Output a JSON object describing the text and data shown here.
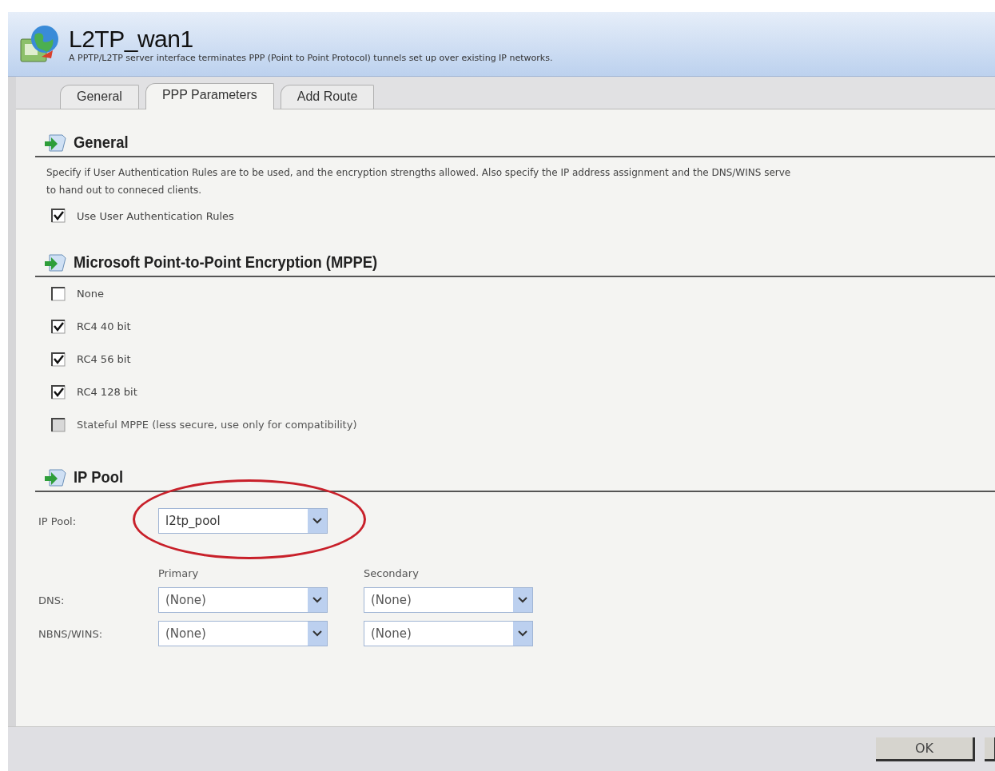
{
  "header": {
    "title": "L2TP_wan1",
    "subtitle": "A PPTP/L2TP server interface terminates PPP (Point to Point Protocol) tunnels set up over existing IP networks."
  },
  "tabs": [
    {
      "label": "General",
      "selected": false
    },
    {
      "label": "PPP Parameters",
      "selected": true
    },
    {
      "label": "Add Route",
      "selected": false
    }
  ],
  "general": {
    "heading": "General",
    "description_lines": [
      "Specify if User Authentication Rules are to be used, and the encryption strengths allowed. Also specify the IP address assignment and the DNS/WINS serve",
      "to hand out to conneced clients."
    ],
    "options": [
      {
        "label": "Use User Authentication Rules",
        "checked": true,
        "disabled": false
      }
    ]
  },
  "mppe": {
    "heading": "Microsoft Point-to-Point Encryption (MPPE)",
    "options": [
      {
        "label": "None",
        "checked": false,
        "disabled": false
      },
      {
        "label": "RC4 40 bit",
        "checked": true,
        "disabled": false
      },
      {
        "label": "RC4 56 bit",
        "checked": true,
        "disabled": false
      },
      {
        "label": "RC4 128 bit",
        "checked": true,
        "disabled": false
      },
      {
        "label": "Stateful MPPE (less secure, use only for compatibility)",
        "checked": false,
        "disabled": true
      }
    ]
  },
  "ip_pool": {
    "heading": "IP Pool",
    "label": "IP Pool:",
    "value": "l2tp_pool",
    "highlighted": true,
    "columns": [
      "Primary",
      "Secondary"
    ],
    "rows": [
      {
        "label": "DNS:",
        "values": [
          "(None)",
          "(None)"
        ]
      },
      {
        "label": "NBNS/WINS:",
        "values": [
          "(None)",
          "(None)"
        ]
      }
    ]
  },
  "buttons": [
    "OK"
  ]
}
